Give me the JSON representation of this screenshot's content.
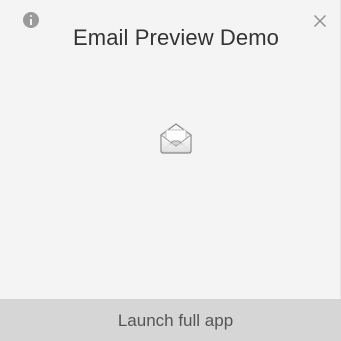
{
  "widget": {
    "title": "Email Preview Demo",
    "info_icon": "info-icon",
    "close_icon": "close-icon",
    "app_icon": "envelope-icon"
  },
  "footer": {
    "launch_label": "Launch full app"
  },
  "colors": {
    "background": "#f4f4f4",
    "footer_background": "#d6d6d6",
    "title_text": "#333333",
    "icon_gray": "#9a9a9a"
  }
}
